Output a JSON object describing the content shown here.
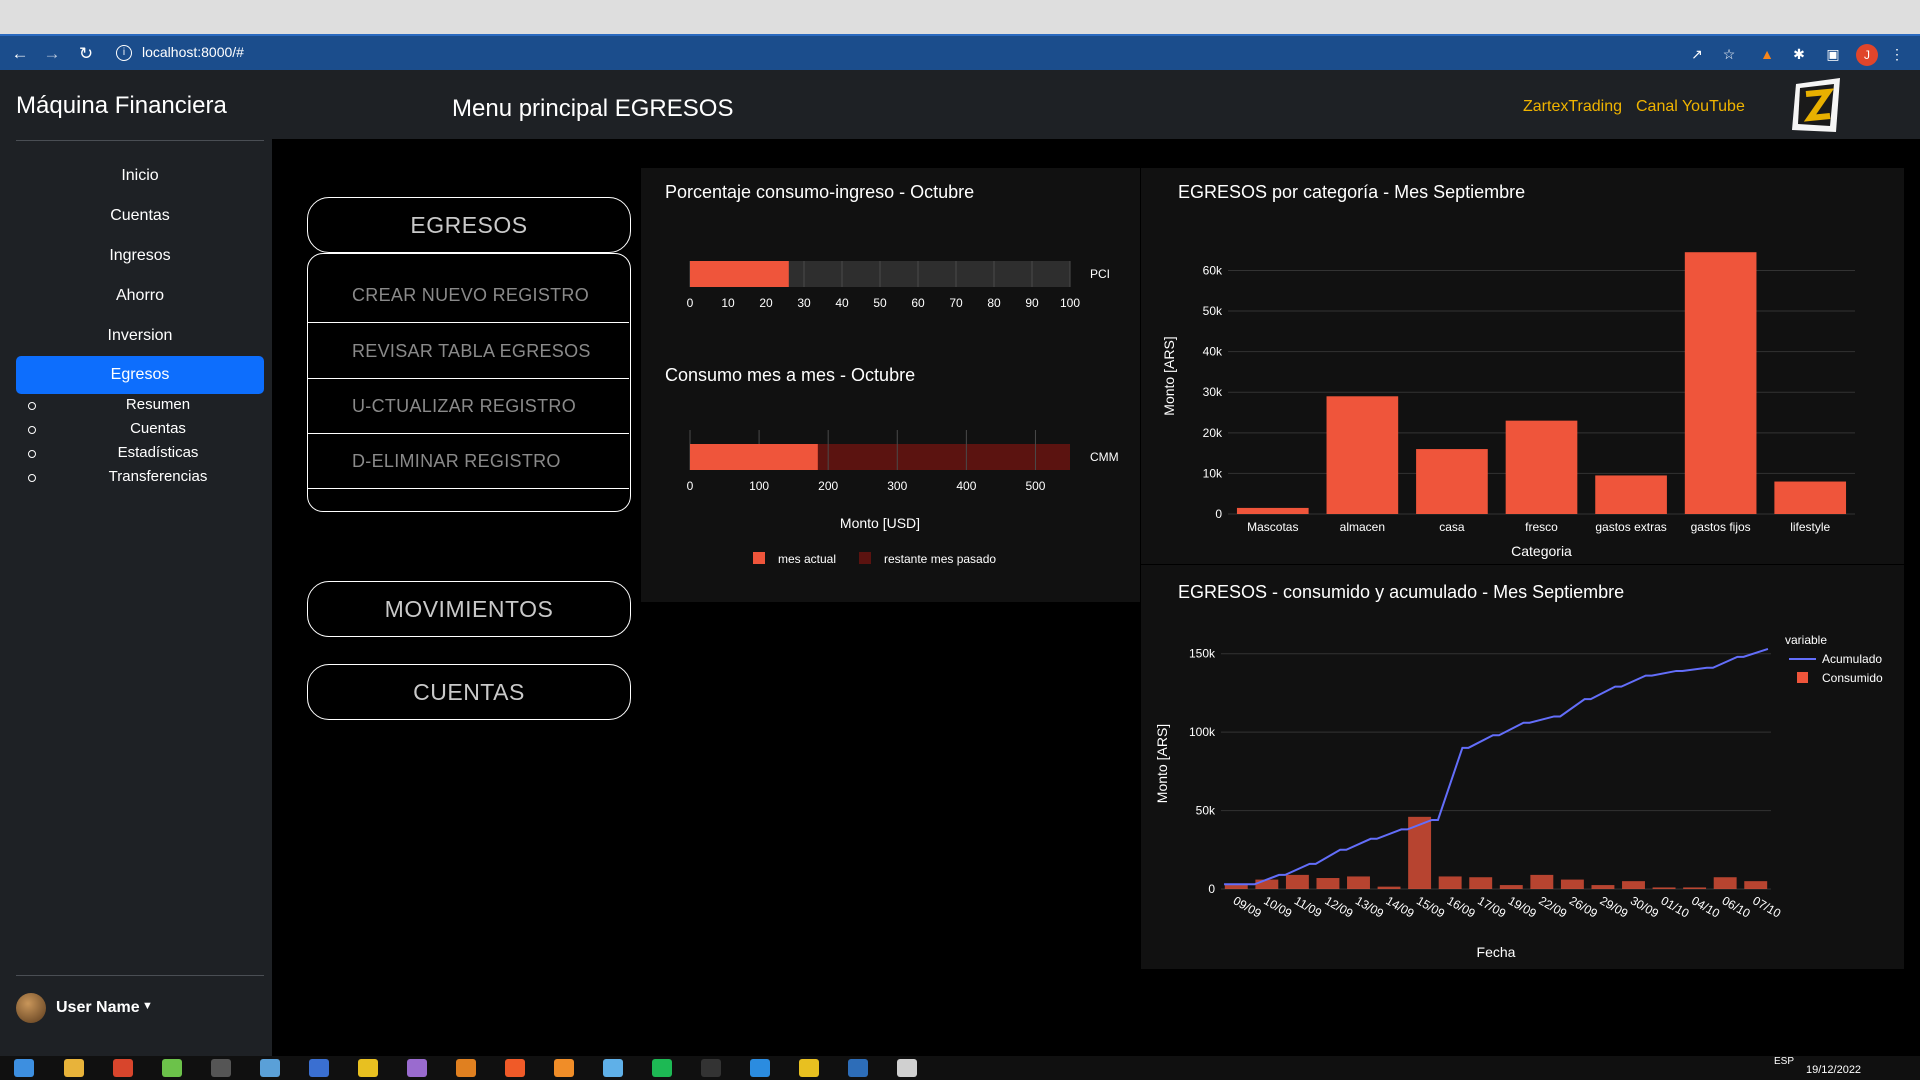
{
  "browser": {
    "url": "localhost:8000/#"
  },
  "header": {
    "brand": "Máquina Financiera",
    "page_title": "Menu principal EGRESOS",
    "links": [
      "ZartexTrading",
      "Canal YouTube"
    ]
  },
  "sidebar": {
    "items": [
      {
        "label": "Inicio",
        "active": false
      },
      {
        "label": "Cuentas",
        "active": false
      },
      {
        "label": "Ingresos",
        "active": false
      },
      {
        "label": "Ahorro",
        "active": false
      },
      {
        "label": "Inversion",
        "active": false
      },
      {
        "label": "Egresos",
        "active": true
      }
    ],
    "subitems": [
      "Resumen",
      "Cuentas",
      "Estadísticas",
      "Transferencias"
    ],
    "user": "User Name"
  },
  "menu": {
    "egresos_label": "EGRESOS",
    "actions": [
      "CREAR NUEVO REGISTRO",
      "REVISAR TABLA EGRESOS",
      "U-CTUALIZAR REGISTRO",
      "D-ELIMINAR REGISTRO"
    ],
    "movimientos_label": "MOVIMIENTOS",
    "cuentas_label": "CUENTAS"
  },
  "chart_data": [
    {
      "type": "bar",
      "orientation": "horizontal",
      "title": "Porcentaje consumo-ingreso - Octubre",
      "categories": [
        "PCI"
      ],
      "series": [
        {
          "name": "",
          "values": [
            26
          ]
        }
      ],
      "xlim": [
        0,
        100
      ],
      "xticks": [
        0,
        10,
        20,
        30,
        40,
        50,
        60,
        70,
        80,
        90,
        100
      ],
      "background_bar": 100,
      "color": "#ef553b"
    },
    {
      "type": "bar",
      "orientation": "horizontal",
      "title": "Consumo mes a mes - Octubre",
      "categories": [
        "CMM"
      ],
      "series": [
        {
          "name": "mes actual",
          "values": [
            185
          ],
          "color": "#ef553b"
        },
        {
          "name": "restante mes pasado",
          "values": [
            550
          ],
          "color": "#5b1310"
        }
      ],
      "xlim": [
        0,
        550
      ],
      "xticks": [
        0,
        100,
        200,
        300,
        400,
        500
      ],
      "xlabel": "Monto [USD]",
      "legend_labels": [
        "mes actual",
        "restante mes pasado"
      ]
    },
    {
      "type": "bar",
      "title": "EGRESOS por categoría - Mes Septiembre",
      "categories": [
        "Mascotas",
        "almacen",
        "casa",
        "fresco",
        "gastos extras",
        "gastos fijos",
        "lifestyle"
      ],
      "values": [
        1500,
        29000,
        16000,
        23000,
        9500,
        64500,
        8000
      ],
      "xlabel": "Categoria",
      "ylabel": "Monto [ARS]",
      "ylim": [
        0,
        68000
      ],
      "yticks": [
        0,
        10000,
        20000,
        30000,
        40000,
        50000,
        60000
      ],
      "ytick_labels": [
        "0",
        "10k",
        "20k",
        "30k",
        "40k",
        "50k",
        "60k"
      ],
      "color": "#ef553b"
    },
    {
      "type": "line",
      "title": "EGRESOS - consumido y acumulado - Mes Septiembre",
      "x": [
        "09/09",
        "10/09",
        "11/09",
        "12/09",
        "13/09",
        "14/09",
        "15/09",
        "16/09",
        "17/09",
        "19/09",
        "22/09",
        "26/09",
        "29/09",
        "30/09",
        "01/10",
        "04/10",
        "06/10",
        "07/10"
      ],
      "series": [
        {
          "name": "Acumulado",
          "type": "line",
          "color": "#636efa",
          "values": [
            3000,
            9000,
            16000,
            25000,
            32000,
            38000,
            44000,
            90000,
            98000,
            106000,
            110000,
            121000,
            129000,
            136000,
            139000,
            141000,
            148000,
            153000
          ]
        },
        {
          "name": "Consumido",
          "type": "bar",
          "color": "#ef553b",
          "values": [
            3000,
            6000,
            9000,
            7000,
            8000,
            1500,
            46000,
            8000,
            7500,
            2500,
            9000,
            6000,
            2500,
            5000,
            1000,
            1000,
            7500,
            5000
          ]
        }
      ],
      "xlabel": "Fecha",
      "ylabel": "Monto [ARS]",
      "ylim": [
        0,
        160000
      ],
      "yticks": [
        0,
        50000,
        100000,
        150000
      ],
      "ytick_labels": [
        "0",
        "50k",
        "100k",
        "150k"
      ],
      "legend_title": "variable",
      "legend_position": "top-right"
    }
  ],
  "taskbar": {
    "lang": "ESP",
    "date": "19/12/2022"
  }
}
